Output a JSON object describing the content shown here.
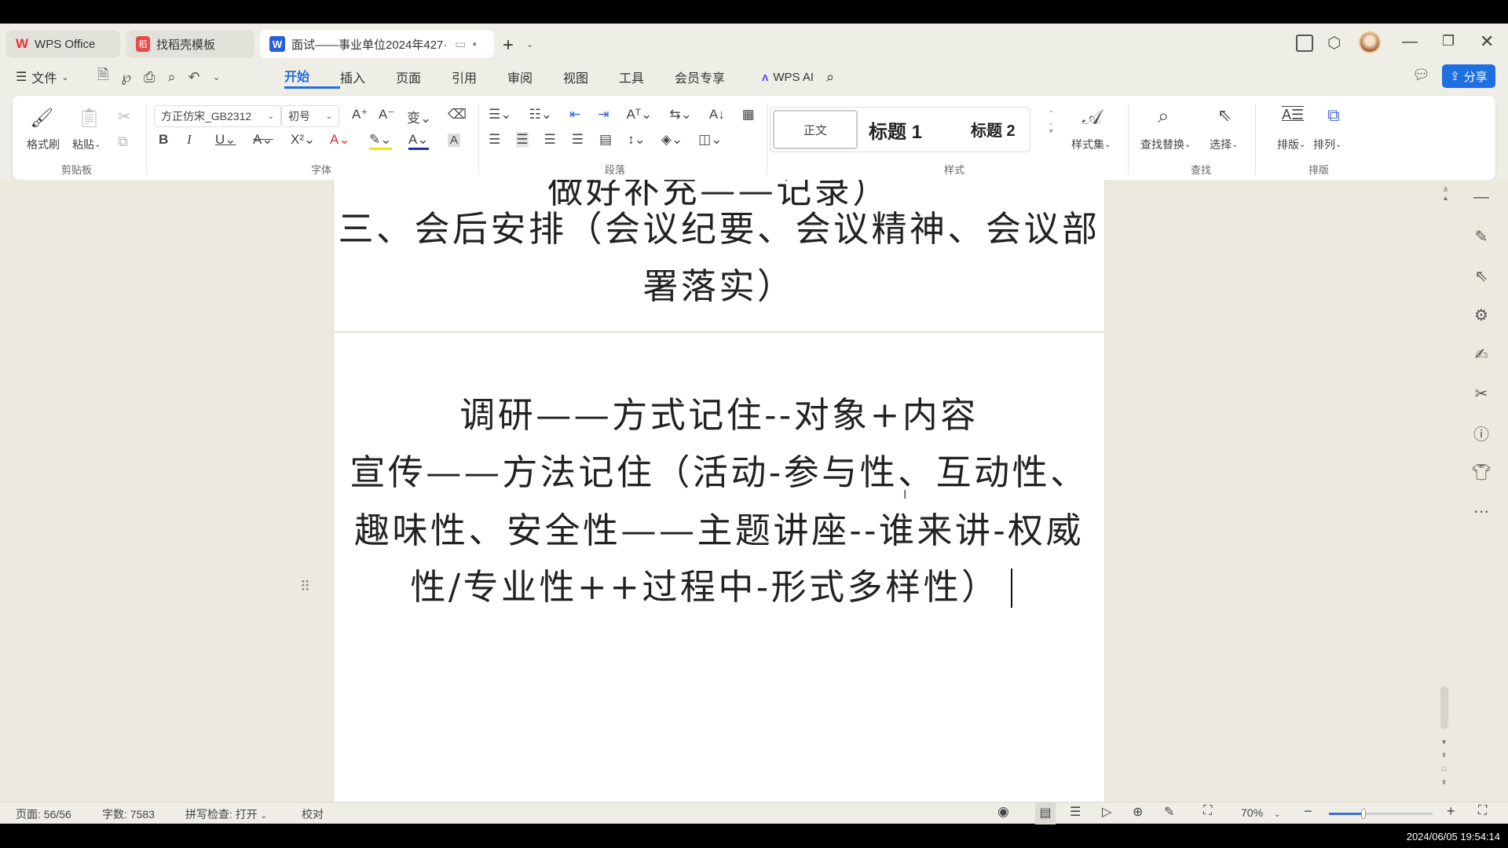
{
  "tabs": [
    {
      "label": "WPS Office",
      "icon": "wps-logo-icon",
      "active": false
    },
    {
      "label": "找稻壳模板",
      "icon": "daoke-icon",
      "active": false
    },
    {
      "label": "面试——事业单位2024年427·",
      "icon": "word-doc-icon",
      "active": true
    }
  ],
  "menu": {
    "file": "文件",
    "tabs": [
      "开始",
      "插入",
      "页面",
      "引用",
      "审阅",
      "视图",
      "工具",
      "会员专享"
    ],
    "active_tab": "开始",
    "wps_ai": "WPS AI",
    "share": "分享"
  },
  "ribbon": {
    "clipboard": {
      "group": "剪贴板",
      "format_painter": "格式刷",
      "paste": "粘贴"
    },
    "font": {
      "group": "字体",
      "font_name": "方正仿宋_GB2312",
      "font_size": "初号"
    },
    "paragraph": {
      "group": "段落"
    },
    "styles": {
      "group": "样式",
      "items": [
        "正文",
        "标题 1",
        "标题 2"
      ],
      "style_set": "样式集"
    },
    "find": {
      "group": "查找",
      "find_replace": "查找替换",
      "select": "选择"
    },
    "layout": {
      "group": "排版",
      "typeset": "排版",
      "arrange": "排列"
    }
  },
  "document": {
    "page1_lines": [
      "做好补充——记录）",
      "三、会后安排（会议纪要、会议精神、会议部",
      "署落实）"
    ],
    "page2_lines": [
      "调研——方式记住--对象+内容",
      "宣传——方法记住（活动-参与性、互动性、",
      "趣味性、安全性——主题讲座--谁来讲-权威",
      "性/专业性++过程中-形式多样性）"
    ]
  },
  "status": {
    "page": "页面: 56/56",
    "words": "字数: 7583",
    "spell": "拼写检查: 打开",
    "proof": "校对",
    "zoom": "70%",
    "zoom_percent": 70
  },
  "timestamp": "2024/06/05 19:54:14",
  "colors": {
    "accent": "#1f6fe0",
    "share_bg": "#1f6fe0",
    "page_bg": "#eceade"
  }
}
